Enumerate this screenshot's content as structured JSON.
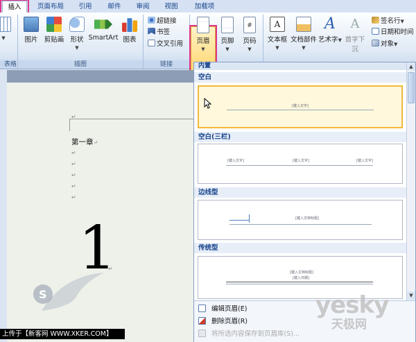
{
  "tabs": [
    {
      "label": "插入",
      "active": true
    },
    {
      "label": "页面布局",
      "active": false
    },
    {
      "label": "引用",
      "active": false
    },
    {
      "label": "邮件",
      "active": false
    },
    {
      "label": "审阅",
      "active": false
    },
    {
      "label": "视图",
      "active": false
    },
    {
      "label": "加载项",
      "active": false
    }
  ],
  "ribbon": {
    "table_group_label": "表格",
    "illustrations": {
      "picture": "图片",
      "clipart": "剪贴画",
      "shapes": "形状",
      "smartart": "SmartArt",
      "chart": "图表",
      "group_label": "插图"
    },
    "links": {
      "hyperlink": "超链接",
      "bookmark": "书签",
      "crossref": "交叉引用",
      "group_label": "链接"
    },
    "header_footer": {
      "header": "页眉",
      "footer": "页脚",
      "page_number": "页码"
    },
    "text": {
      "textbox": "文本框",
      "quickparts": "文档部件",
      "wordart": "艺术字",
      "dropcap": "首字下沉",
      "signature": "签名行",
      "datetime": "日期和时间",
      "object": "对象"
    }
  },
  "document": {
    "chapter": "第一章",
    "para_mark": "↵",
    "big_number": "1"
  },
  "gallery": {
    "header": "内置",
    "categories": [
      {
        "name": "空白",
        "thumb_texts": [
          "[键入文字]"
        ]
      },
      {
        "name": "空白(三栏)",
        "thumb_texts": [
          "[键入文字]",
          "[键入文字]",
          "[键入文字]"
        ]
      },
      {
        "name": "边线型",
        "thumb_texts": [
          "[键入文档标题]"
        ]
      },
      {
        "name": "传统型",
        "thumb_texts": [
          "[键入文档标题]",
          "[键入日期]"
        ]
      }
    ],
    "menu": [
      {
        "label": "编辑页眉(E)",
        "enabled": true
      },
      {
        "label": "删除页眉(R)",
        "enabled": true
      },
      {
        "label": "将所选内容保存到页眉库(S)...",
        "enabled": false
      }
    ]
  },
  "watermarks": {
    "yesky": "yesky",
    "yesky_sub": "天极网",
    "upload": "上传于【新客网 WWW.XKER.COM】"
  },
  "colors": {
    "tab_highlight": "#e0368a",
    "selected_border": "#f2b83a",
    "ribbon_text": "#15428b"
  }
}
